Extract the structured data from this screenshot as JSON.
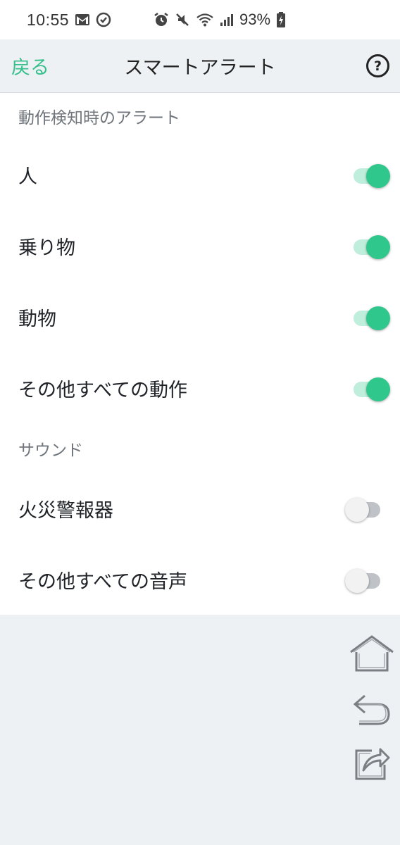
{
  "status_bar": {
    "time": "10:55",
    "battery": "93%",
    "icons": [
      "gmail-icon",
      "sync-icon",
      "alarm-icon",
      "mute-icon",
      "wifi-icon",
      "signal-icon",
      "battery-charging-icon"
    ]
  },
  "header": {
    "back_label": "戻る",
    "title": "スマートアラート",
    "help_icon": "?"
  },
  "motion_section": {
    "title": "動作検知時のアラート",
    "items": [
      {
        "label": "人",
        "enabled": true
      },
      {
        "label": "乗り物",
        "enabled": true
      },
      {
        "label": "動物",
        "enabled": true
      },
      {
        "label": "その他すべての動作",
        "enabled": true
      }
    ]
  },
  "sound_section": {
    "title": "サウンド",
    "items": [
      {
        "label": "火災警報器",
        "enabled": false
      },
      {
        "label": "その他すべての音声",
        "enabled": false
      }
    ]
  },
  "floating_icons": [
    "home-icon",
    "undo-icon",
    "share-icon"
  ],
  "colors": {
    "accent": "#30c78d",
    "accent_track": "#bfeedc",
    "background": "#eef1f4"
  }
}
